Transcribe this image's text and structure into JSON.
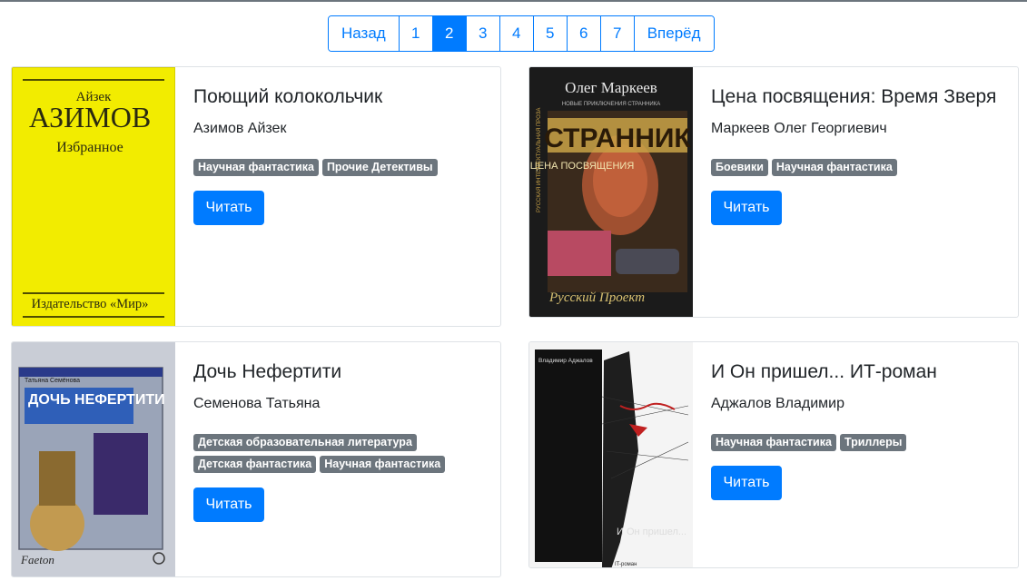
{
  "pagination": {
    "prev_label": "Назад",
    "next_label": "Вперёд",
    "pages": [
      "1",
      "2",
      "3",
      "4",
      "5",
      "6",
      "7"
    ],
    "active_page": "2"
  },
  "books": [
    {
      "title": "Поющий колокольчик",
      "author": "Азимов Айзек",
      "genres": [
        "Научная фантастика",
        "Прочие Детективы"
      ],
      "read_label": "Читать",
      "cover": {
        "author_line": "Айзек",
        "surname": "АЗИМОВ",
        "subtitle": "Избранное",
        "publisher": "Издательство «Мир»"
      }
    },
    {
      "title": "Цена посвящения: Время Зверя",
      "author": "Маркеев Олег Георгиевич",
      "genres": [
        "Боевики",
        "Научная фантастика"
      ],
      "read_label": "Читать",
      "cover": {
        "author_line": "Олег Маркеев",
        "series": "НОВЫЕ ПРИКЛЮЧЕНИЯ СТРАННИКА",
        "big": "СТРАННИК",
        "subtitle": "ЦЕНА ПОСВЯЩЕНИЯ",
        "side": "РУССКАЯ ИНТЕЛЛЕКТУАЛЬНАЯ ПРОЗА",
        "sign": "Русский Проект"
      }
    },
    {
      "title": "Дочь Нефертити",
      "author": "Семенова Татьяна",
      "genres": [
        "Детская образовательная литература",
        "Детская фантастика",
        "Научная фантастика"
      ],
      "read_label": "Читать",
      "cover": {
        "author_line": "Татьяна Семёнова",
        "big": "ДОЧЬ НЕФЕРТИТИ",
        "publisher": "Faeton"
      }
    },
    {
      "title": "И Он пришел... ИТ-роман",
      "author": "Аджалов Владимир",
      "genres": [
        "Научная фантастика",
        "Триллеры"
      ],
      "read_label": "Читать",
      "cover": {
        "author_line": "Владимир Аджалов",
        "subtitle": "И Он пришел...",
        "caption": "IT-роман"
      }
    }
  ]
}
